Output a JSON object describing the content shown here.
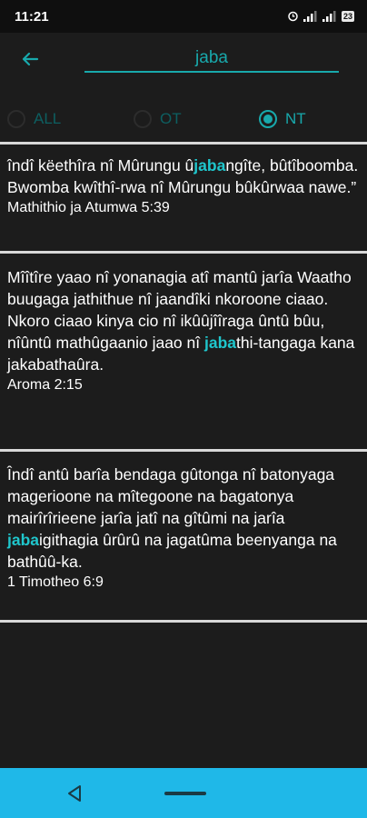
{
  "status": {
    "time": "11:21",
    "battery": "23"
  },
  "search": {
    "value": "jaba"
  },
  "filters": [
    {
      "label": "ALL",
      "checked": false
    },
    {
      "label": "OT",
      "checked": false
    },
    {
      "label": "NT",
      "checked": true
    }
  ],
  "results": [
    {
      "before": "îndî këethîra nî Mûrungu û",
      "match": "jaba",
      "after": "ngîte, bûtîboomba. Bwomba kwîthî-rwa nî Mûrungu bûkûrwaa nawe.”",
      "reference": "Mathithio ja Atumwa 5:39"
    },
    {
      "before": "Mîîtîre yaao nî yonanagia atî mantû jarîa Waatho buugaga jathithue nî jaandîki nkoroone ciaao. Nkoro ciaao kinya cio nî ikûûjîîraga ûntû bûu, nîûntû mathûgaanio jaao nî ",
      "match": "jaba",
      "after": "thi-tangaga kana jakabathaûra.",
      "reference": "Aroma 2:15"
    },
    {
      "before": "Îndî antû barîa bendaga gûtonga nî batonyaga magerioone na mîtegoone na bagatonya mairîrîrieene jarîa jatî na gîtûmi na jarîa ",
      "match": "jaba",
      "after": "igithagia ûrûrû na jagatûma beenyanga na bathûû-ka.",
      "reference": "1 Timotheo 6:9"
    }
  ],
  "colors": {
    "accent": "#18a9ac",
    "highlight": "#1fc6cc",
    "nav_bar": "#1fb8e8",
    "background": "#1c1c1c"
  },
  "icons": {
    "back": "arrow-left-icon",
    "nav_back": "triangle-back-icon",
    "nav_home": "home-pill-icon"
  }
}
